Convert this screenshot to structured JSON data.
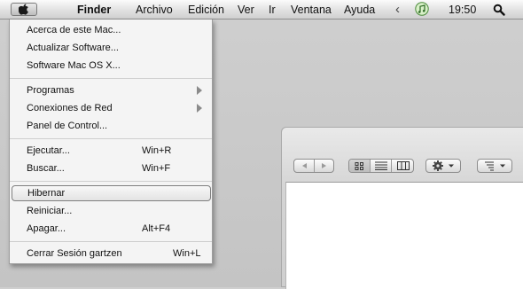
{
  "menubar": {
    "app_name": "Finder",
    "menus": [
      "Archivo",
      "Edición",
      "Ver",
      "Ir",
      "Ventana",
      "Ayuda"
    ],
    "clock": "19:50",
    "icons": [
      "apple-icon",
      "chevron-left-icon",
      "itunes-icon",
      "spotlight-search-icon"
    ]
  },
  "apple_menu": {
    "items": [
      {
        "label": "Acerca de este Mac..."
      },
      {
        "label": "Actualizar Software..."
      },
      {
        "label": "Software Mac OS X..."
      },
      {
        "label": "Programas",
        "submenu": true
      },
      {
        "label": "Conexiones de Red",
        "submenu": true
      },
      {
        "label": "Panel de Control..."
      },
      {
        "label": "Ejecutar...",
        "shortcut": "Win+R"
      },
      {
        "label": "Buscar...",
        "shortcut": "Win+F"
      },
      {
        "label": "Hibernar",
        "selected": true
      },
      {
        "label": "Reiniciar..."
      },
      {
        "label": "Apagar...",
        "shortcut": "Alt+F4"
      },
      {
        "label": "Cerrar Sesión gartzen",
        "shortcut": "Win+L"
      }
    ]
  },
  "finder_window": {
    "toolbar_icons": [
      "back-icon",
      "forward-icon",
      "icon-view-icon",
      "list-view-icon",
      "column-view-icon",
      "gear-action-icon",
      "arrange-icon"
    ]
  },
  "colors": {
    "menubar_top": "#fbfbfb",
    "menubar_bottom": "#cfcfcf",
    "menu_bg": "#f4f4f4",
    "desktop": "#c8c8c8"
  }
}
